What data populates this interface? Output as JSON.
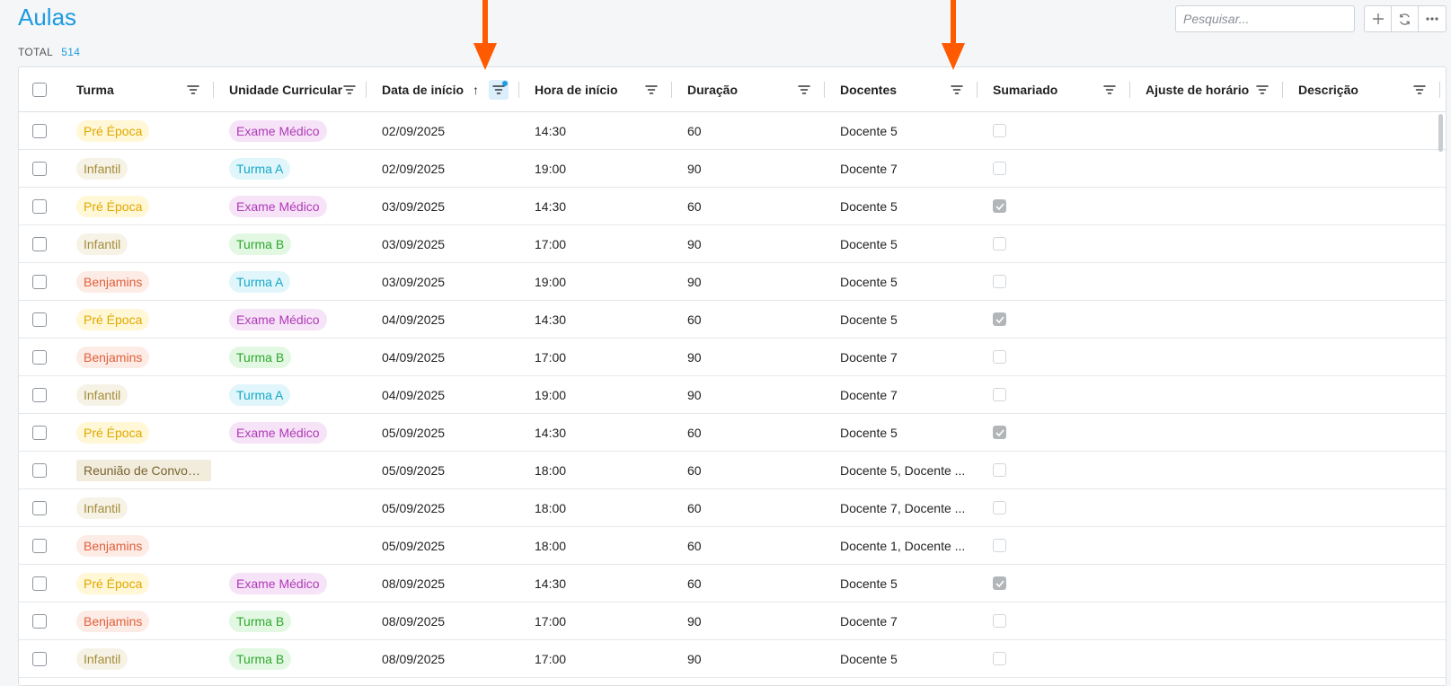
{
  "page": {
    "title": "Aulas",
    "total_label": "TOTAL",
    "total_count": "514"
  },
  "toolbar": {
    "search_placeholder": "Pesquisar...",
    "add_icon": "plus-icon",
    "refresh_icon": "refresh-icon",
    "more_icon": "more-icon"
  },
  "colors": {
    "accent": "#1c9be0",
    "annotation_arrow": "#ff5a00"
  },
  "columns": [
    {
      "key": "turma",
      "label": "Turma"
    },
    {
      "key": "uc",
      "label": "Unidade Curricular"
    },
    {
      "key": "data",
      "label": "Data de início",
      "sorted": "asc",
      "filter_active": true
    },
    {
      "key": "hora",
      "label": "Hora de início"
    },
    {
      "key": "dur",
      "label": "Duração"
    },
    {
      "key": "doc",
      "label": "Docentes"
    },
    {
      "key": "sum",
      "label": "Sumariado"
    },
    {
      "key": "aj",
      "label": "Ajuste de horário"
    },
    {
      "key": "desc",
      "label": "Descrição"
    }
  ],
  "tag_styles": {
    "Pré Época": {
      "bg": "#fff7d6",
      "fg": "#e0a800"
    },
    "Infantil": {
      "bg": "#f6f3e6",
      "fg": "#a48c3a"
    },
    "Benjamins": {
      "bg": "#fdebe6",
      "fg": "#e0603a"
    },
    "Reunião de Convoc...": {
      "bg": "#f1ecdc",
      "fg": "#7a6430"
    },
    "Exame Médico": {
      "bg": "#f6e3f7",
      "fg": "#b03ab8"
    },
    "Turma A": {
      "bg": "#e0f6fb",
      "fg": "#17a8c8"
    },
    "Turma B": {
      "bg": "#e3f8e3",
      "fg": "#2ea82e"
    }
  },
  "rows": [
    {
      "turma": "Pré Época",
      "uc": "Exame Médico",
      "data": "02/09/2025",
      "hora": "14:30",
      "dur": "60",
      "doc": "Docente 5",
      "sum": false
    },
    {
      "turma": "Infantil",
      "uc": "Turma A",
      "data": "02/09/2025",
      "hora": "19:00",
      "dur": "90",
      "doc": "Docente 7",
      "sum": false
    },
    {
      "turma": "Pré Época",
      "uc": "Exame Médico",
      "data": "03/09/2025",
      "hora": "14:30",
      "dur": "60",
      "doc": "Docente 5",
      "sum": true
    },
    {
      "turma": "Infantil",
      "uc": "Turma B",
      "data": "03/09/2025",
      "hora": "17:00",
      "dur": "90",
      "doc": "Docente 5",
      "sum": false
    },
    {
      "turma": "Benjamins",
      "uc": "Turma A",
      "data": "03/09/2025",
      "hora": "19:00",
      "dur": "90",
      "doc": "Docente 5",
      "sum": false
    },
    {
      "turma": "Pré Época",
      "uc": "Exame Médico",
      "data": "04/09/2025",
      "hora": "14:30",
      "dur": "60",
      "doc": "Docente 5",
      "sum": true
    },
    {
      "turma": "Benjamins",
      "uc": "Turma B",
      "data": "04/09/2025",
      "hora": "17:00",
      "dur": "90",
      "doc": "Docente 7",
      "sum": false
    },
    {
      "turma": "Infantil",
      "uc": "Turma A",
      "data": "04/09/2025",
      "hora": "19:00",
      "dur": "90",
      "doc": "Docente 7",
      "sum": false
    },
    {
      "turma": "Pré Época",
      "uc": "Exame Médico",
      "data": "05/09/2025",
      "hora": "14:30",
      "dur": "60",
      "doc": "Docente 5",
      "sum": true
    },
    {
      "turma": "Reunião de Convoc...",
      "uc": "",
      "data": "05/09/2025",
      "hora": "18:00",
      "dur": "60",
      "doc": "Docente 5, Docente ...",
      "sum": false
    },
    {
      "turma": "Infantil",
      "uc": "",
      "data": "05/09/2025",
      "hora": "18:00",
      "dur": "60",
      "doc": "Docente 7, Docente ...",
      "sum": false
    },
    {
      "turma": "Benjamins",
      "uc": "",
      "data": "05/09/2025",
      "hora": "18:00",
      "dur": "60",
      "doc": "Docente 1, Docente ...",
      "sum": false
    },
    {
      "turma": "Pré Época",
      "uc": "Exame Médico",
      "data": "08/09/2025",
      "hora": "14:30",
      "dur": "60",
      "doc": "Docente 5",
      "sum": true
    },
    {
      "turma": "Benjamins",
      "uc": "Turma B",
      "data": "08/09/2025",
      "hora": "17:00",
      "dur": "90",
      "doc": "Docente 7",
      "sum": false
    },
    {
      "turma": "Infantil",
      "uc": "Turma B",
      "data": "08/09/2025",
      "hora": "17:00",
      "dur": "90",
      "doc": "Docente 5",
      "sum": false
    }
  ]
}
